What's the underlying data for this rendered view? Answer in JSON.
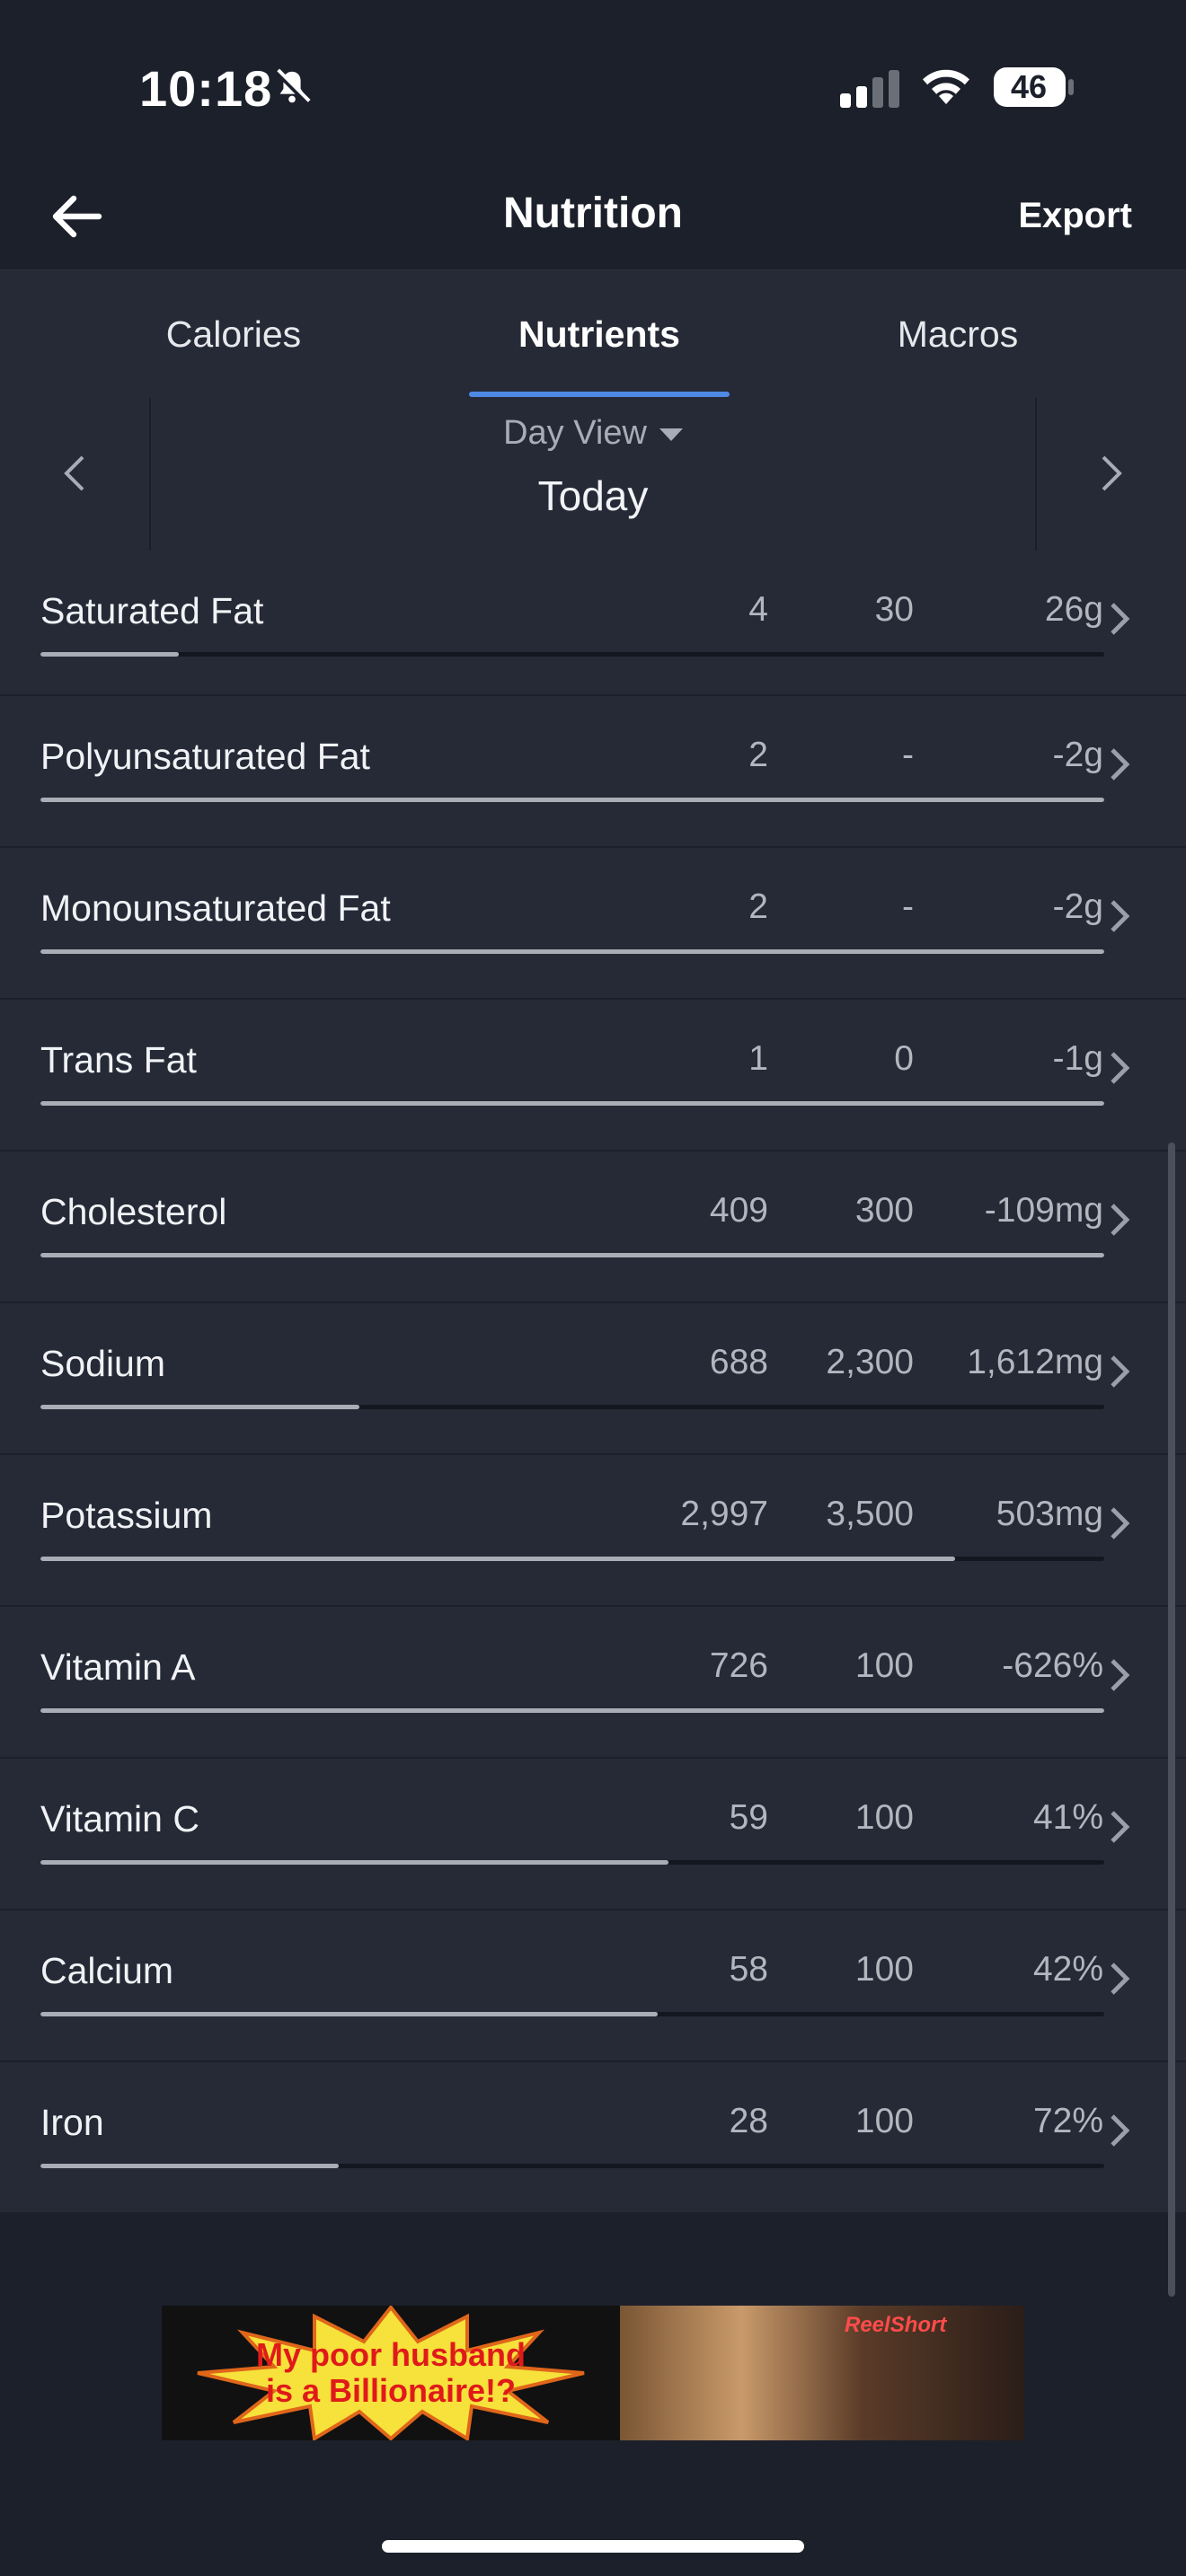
{
  "status_bar": {
    "time": "10:18",
    "battery": "46"
  },
  "header": {
    "title": "Nutrition",
    "export_label": "Export"
  },
  "tabs": [
    {
      "label": "Calories",
      "active": false
    },
    {
      "label": "Nutrients",
      "active": true
    },
    {
      "label": "Macros",
      "active": false
    }
  ],
  "day_nav": {
    "view_label": "Day View",
    "date_label": "Today"
  },
  "nutrients": [
    {
      "name": "Saturated Fat",
      "total": "4",
      "goal": "30",
      "left": "26g",
      "progress": 0.13
    },
    {
      "name": "Polyunsaturated Fat",
      "total": "2",
      "goal": "-",
      "left": "-2g",
      "progress": 1.0
    },
    {
      "name": "Monounsaturated Fat",
      "total": "2",
      "goal": "-",
      "left": "-2g",
      "progress": 1.0
    },
    {
      "name": "Trans Fat",
      "total": "1",
      "goal": "0",
      "left": "-1g",
      "progress": 1.0
    },
    {
      "name": "Cholesterol",
      "total": "409",
      "goal": "300",
      "left": "-109mg",
      "progress": 1.0
    },
    {
      "name": "Sodium",
      "total": "688",
      "goal": "2,300",
      "left": "1,612mg",
      "progress": 0.3
    },
    {
      "name": "Potassium",
      "total": "2,997",
      "goal": "3,500",
      "left": "503mg",
      "progress": 0.86
    },
    {
      "name": "Vitamin A",
      "total": "726",
      "goal": "100",
      "left": "-626%",
      "progress": 1.0
    },
    {
      "name": "Vitamin C",
      "total": "59",
      "goal": "100",
      "left": "41%",
      "progress": 0.59
    },
    {
      "name": "Calcium",
      "total": "58",
      "goal": "100",
      "left": "42%",
      "progress": 0.58
    },
    {
      "name": "Iron",
      "total": "28",
      "goal": "100",
      "left": "72%",
      "progress": 0.28
    }
  ],
  "ad": {
    "headline": "My poor husband is a Billionaire!?",
    "brand": "ReelShort"
  },
  "colors": {
    "background": "#1c202b",
    "row": "#262a36",
    "accent": "#4f89e6",
    "bar_fill": "#a9adb6"
  }
}
